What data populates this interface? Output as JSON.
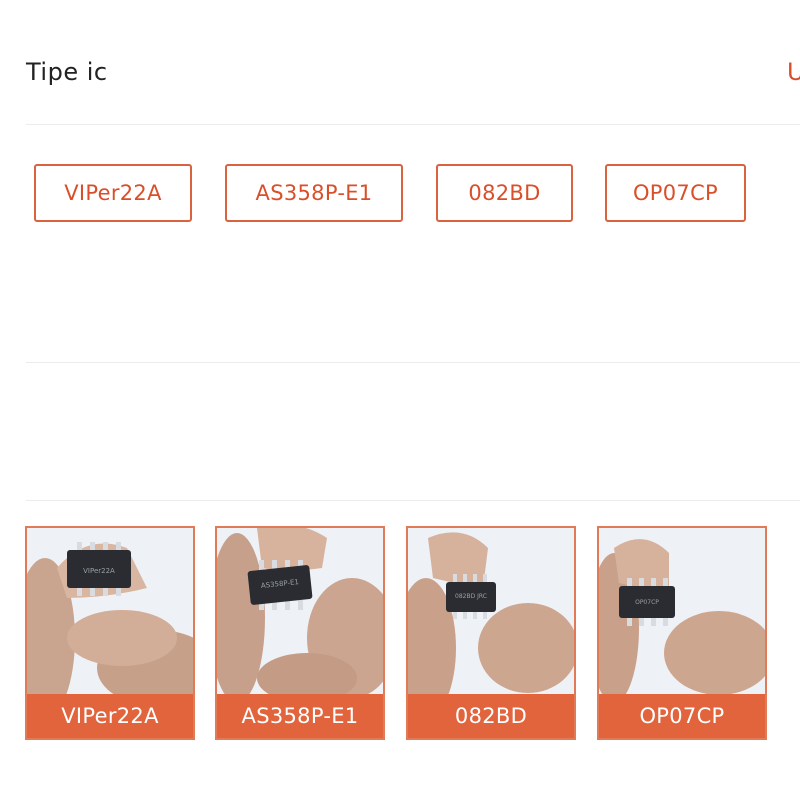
{
  "section": {
    "title": "Tipe ic",
    "link_partial": "U"
  },
  "variants": [
    {
      "label": "VIPer22A"
    },
    {
      "label": "AS358P-E1"
    },
    {
      "label": "082BD"
    },
    {
      "label": "OP07CP"
    }
  ],
  "gallery": [
    {
      "caption": "VIPer22A",
      "chip_marking": "VIPer22A"
    },
    {
      "caption": "AS358P-E1",
      "chip_marking": "AS358P-E1"
    },
    {
      "caption": "082BD",
      "chip_marking": "082BD JRC"
    },
    {
      "caption": "OP07CP",
      "chip_marking": "OP07CP"
    }
  ],
  "colors": {
    "accent": "#d94f2a",
    "caption_bg": "#e1643d",
    "chip_body": "#2a2c31"
  }
}
